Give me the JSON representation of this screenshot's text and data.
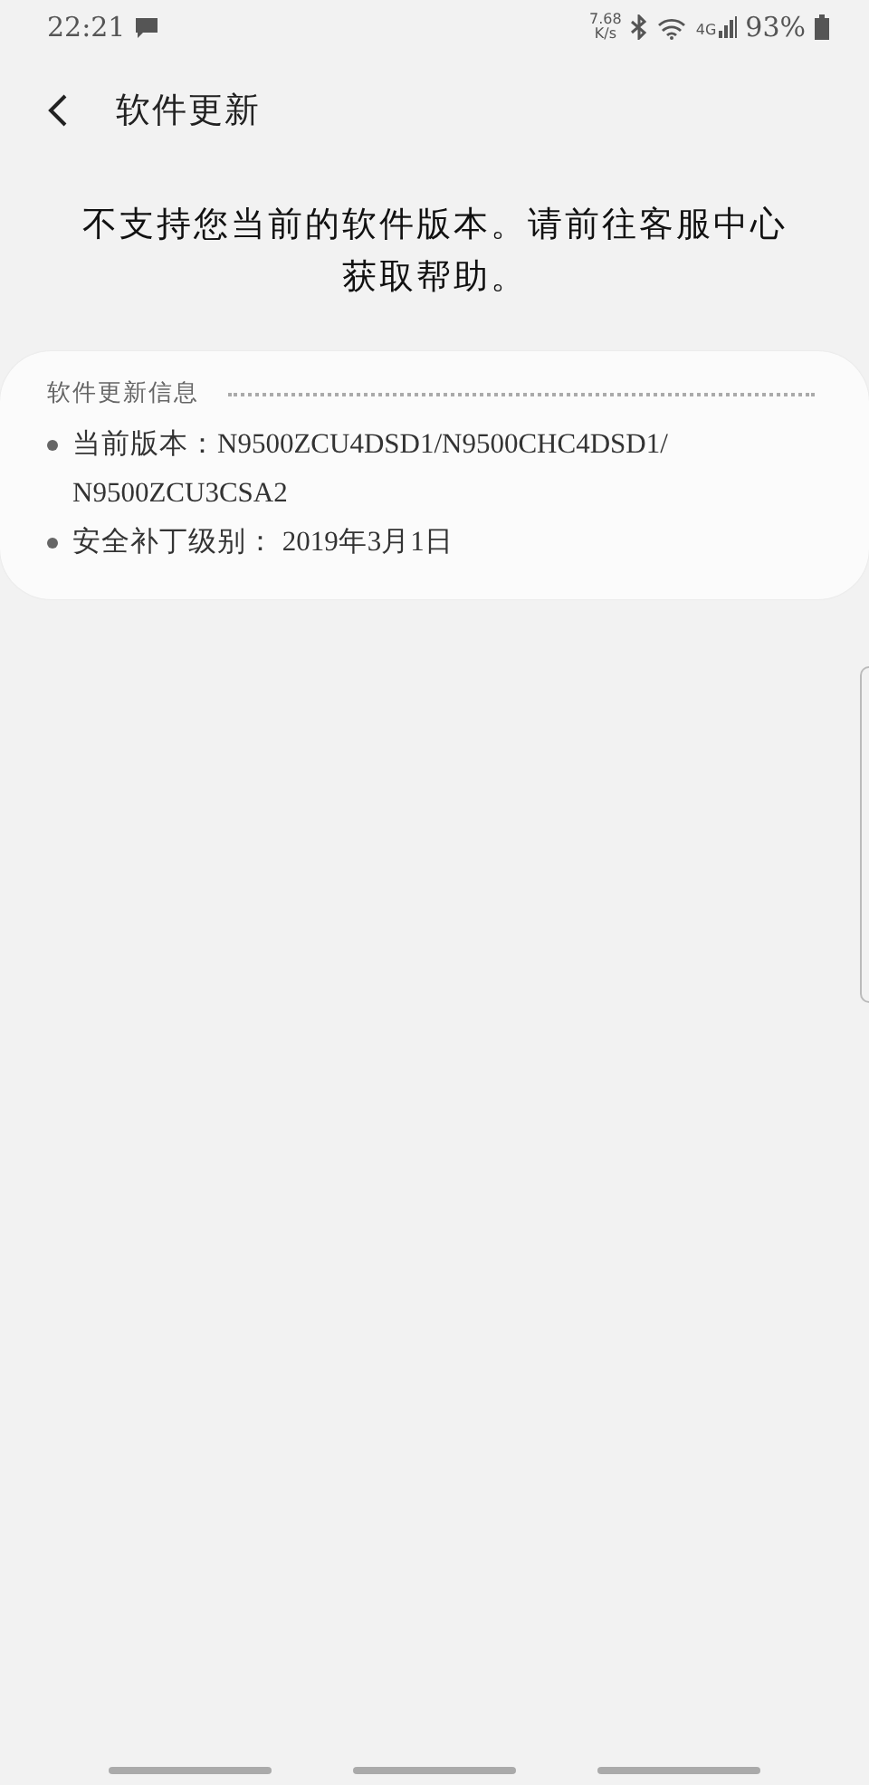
{
  "status_bar": {
    "time": "22:21",
    "net_speed": "7.68",
    "net_speed_unit": "K/s",
    "network": "4G",
    "battery": "93%"
  },
  "header": {
    "title": "软件更新"
  },
  "message": "不支持您当前的软件版本。请前往客服中心获取帮助。",
  "info_card": {
    "title": "软件更新信息",
    "items": [
      "当前版本：N9500ZCU4DSD1/N9500CHC4DSD1/N9500ZCU3CSA2",
      "安全补丁级别： 2019年3月1日"
    ]
  }
}
